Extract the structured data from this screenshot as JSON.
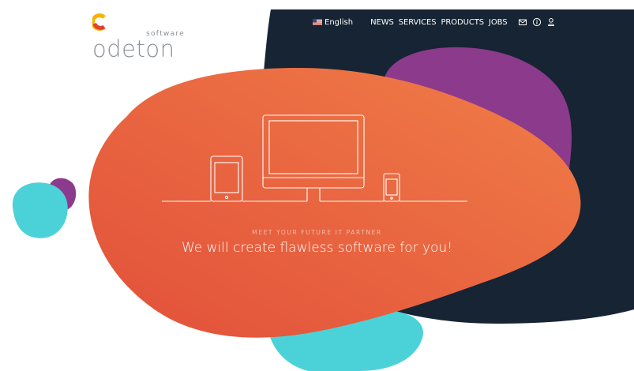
{
  "brand": {
    "name": "odeton",
    "sub": "software",
    "colors": {
      "gray": "#8a8f95",
      "yellow": "#f5b400",
      "red": "#e4402b"
    }
  },
  "nav": {
    "language": "English",
    "items": [
      {
        "label": "NEWS"
      },
      {
        "label": "SERVICES"
      },
      {
        "label": "PRODUCTS"
      },
      {
        "label": "JOBS"
      }
    ],
    "icons": [
      "mail-icon",
      "info-icon",
      "user-icon"
    ]
  },
  "hero": {
    "tagline": "MEET YOUR FUTURE IT PARTNER",
    "headline": "We will create flawless software for you!",
    "illustration_icons": [
      "tablet-icon",
      "monitor-icon",
      "phone-icon"
    ]
  },
  "colors": {
    "navy": "#172433",
    "purple": "#8c3a8b",
    "orange_start": "#e6533a",
    "orange_end": "#ef7b47",
    "cyan": "#4bd2d8",
    "white": "#ffffff"
  }
}
